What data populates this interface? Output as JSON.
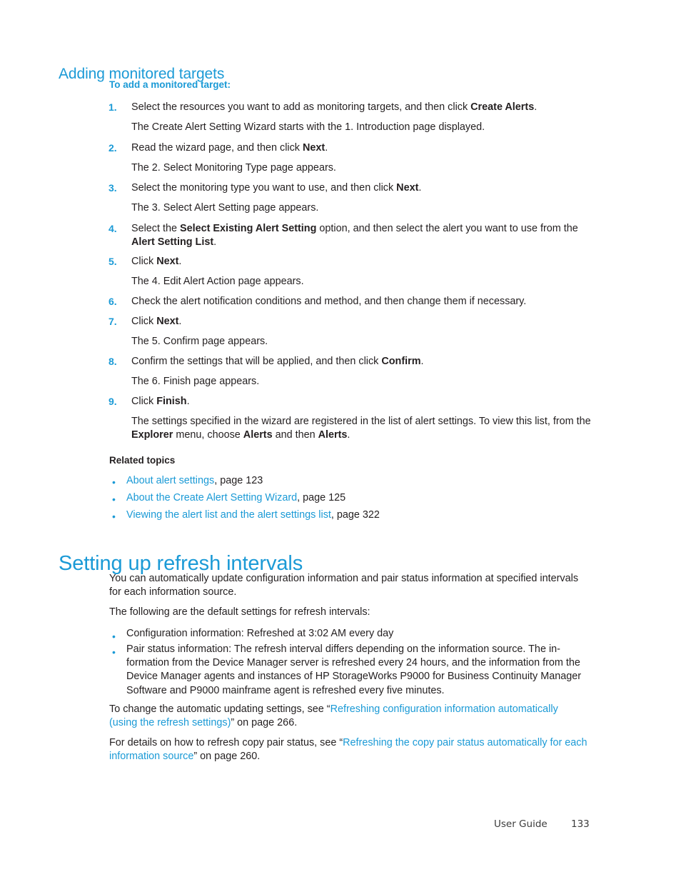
{
  "document": {
    "type": "user-guide-page",
    "accent_color": "#1b9ad6",
    "text_color": "#231f20",
    "background_color": "#ffffff"
  },
  "section1": {
    "heading": "Adding monitored targets",
    "subheading": "To add a monitored target:",
    "steps": [
      {
        "number": "1.",
        "pre": "Select the resources you want to add as monitoring targets, and then click ",
        "bold": "Create Alerts",
        "post": ".",
        "result": "The Create Alert Setting Wizard starts with the 1. Introduction page displayed."
      },
      {
        "number": "2.",
        "pre": "Read the wizard page, and then click ",
        "bold": "Next",
        "post": ".",
        "result": "The 2. Select Monitoring Type page appears."
      },
      {
        "number": "3.",
        "pre": "Select the monitoring type you want to use, and then click ",
        "bold": "Next",
        "post": ".",
        "result": "The 3. Select Alert Setting page appears."
      },
      {
        "number": "4.",
        "pre": "Select the ",
        "bold": "Select Existing Alert Setting",
        "mid": " option, and then select the alert you want to use from the ",
        "bold2": "Alert Setting List",
        "post": ".",
        "result": ""
      },
      {
        "number": "5.",
        "pre": "Click ",
        "bold": "Next",
        "post": ".",
        "result": "The 4. Edit Alert Action page appears."
      },
      {
        "number": "6.",
        "pre": "Check the alert notification conditions and method, and then change them if necessary.",
        "bold": "",
        "post": "",
        "result": ""
      },
      {
        "number": "7.",
        "pre": "Click ",
        "bold": "Next",
        "post": ".",
        "result": "The 5. Confirm page appears."
      },
      {
        "number": "8.",
        "pre": "Confirm the settings that will be applied, and then click ",
        "bold": "Confirm",
        "post": ".",
        "result": "The 6. Finish page appears."
      },
      {
        "number": "9.",
        "pre": "Click ",
        "bold": "Finish",
        "post": ".",
        "result_pre": "The settings specified in the wizard are registered in the list of alert settings. To view this list, from the ",
        "result_bold1": "Explorer",
        "result_mid1": " menu, choose ",
        "result_bold2": "Alerts",
        "result_mid2": " and then ",
        "result_bold3": "Alerts",
        "result_post": "."
      }
    ],
    "related_topics_heading": "Related topics",
    "related_topics": [
      {
        "link": "About alert settings",
        "page_text": ", page 123"
      },
      {
        "link": "About the Create Alert Setting Wizard",
        "page_text": ", page 125"
      },
      {
        "link": "Viewing the alert list and the alert settings list",
        "page_text": ", page 322"
      }
    ]
  },
  "section2": {
    "heading": "Setting up refresh intervals",
    "intro": "You can automatically update configuration information and pair status information at specified intervals for each information source.",
    "defaults_lead": "The following are the default settings for refresh intervals:",
    "bullets": [
      "Configuration information: Refreshed at 3:02 AM every day",
      "Pair status information: The refresh interval differs depending on the information source. The in­formation from the Device Manager server is refreshed every 24 hours, and the information from the Device Manager agents and instances of HP StorageWorks P9000 for Business Continuity Manager Software and P9000 mainframe agent is refreshed every five minutes."
    ],
    "xref1": {
      "pre": "To change the automatic updating settings, see “",
      "link": "Refreshing configuration information automatically (using the refresh settings)",
      "post": "” on page 266."
    },
    "xref2": {
      "pre": "For details on how to refresh copy pair status, see “",
      "link": "Refreshing the copy pair status automatically for each information source",
      "post": "” on page 260."
    }
  },
  "footer": {
    "guide_label": "User Guide",
    "page_number": "133"
  }
}
